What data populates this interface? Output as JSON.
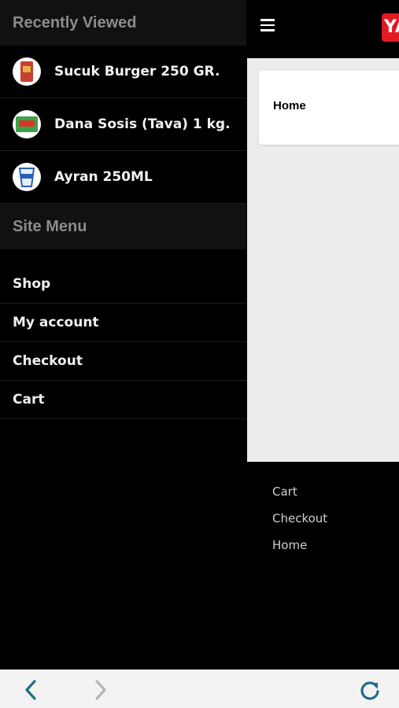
{
  "drawer": {
    "recent_title": "Recently Viewed",
    "recent_items": [
      {
        "label": "Sucuk Burger 250 GR.",
        "icon": "product-thumb-icon"
      },
      {
        "label": "Dana Sosis (Tava) 1 kg.",
        "icon": "product-thumb-icon"
      },
      {
        "label": "Ayran 250ML",
        "icon": "product-thumb-icon"
      }
    ],
    "menu_title": "Site Menu",
    "menu_items": [
      "Shop",
      "My account",
      "Checkout",
      "Cart"
    ]
  },
  "header": {
    "menu_icon": "hamburger-icon",
    "logo_text": "YA",
    "brand_color": "#e21b23"
  },
  "main": {
    "home_card_label": "Home"
  },
  "footer": {
    "links": [
      "Cart",
      "Checkout",
      "Home"
    ]
  },
  "browser_bar": {
    "back_icon": "chevron-left-icon",
    "forward_icon": "chevron-right-icon",
    "reload_icon": "reload-icon",
    "accent_color": "#1e6f86"
  }
}
